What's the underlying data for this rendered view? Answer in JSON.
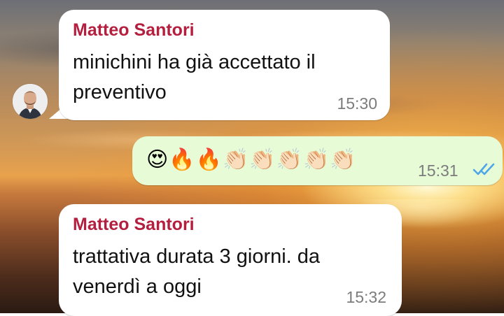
{
  "messages": [
    {
      "direction": "incoming",
      "sender": "Matteo Santori",
      "text_lines": [
        "minichini ha già accettato il",
        "preventivo"
      ],
      "time": "15:30"
    },
    {
      "direction": "outgoing",
      "emojis": "😍🔥🔥👏🏻👏🏻👏🏻👏🏻👏🏻",
      "time": "15:31",
      "status": "read",
      "status_icon": "double-check-icon"
    },
    {
      "direction": "incoming",
      "sender": "Matteo Santori",
      "text_lines": [
        "trattativa durata 3 giorni. da",
        "venerdì a oggi"
      ],
      "time": "15:32"
    }
  ],
  "colors": {
    "sender_name": "#b51f3f",
    "incoming_bubble": "#ffffff",
    "outgoing_bubble": "#e7fbd6",
    "read_ticks": "#4fa6e8",
    "timestamp": "#7c7c7c"
  },
  "icons": {
    "contact_avatar": "avatar-icon"
  }
}
